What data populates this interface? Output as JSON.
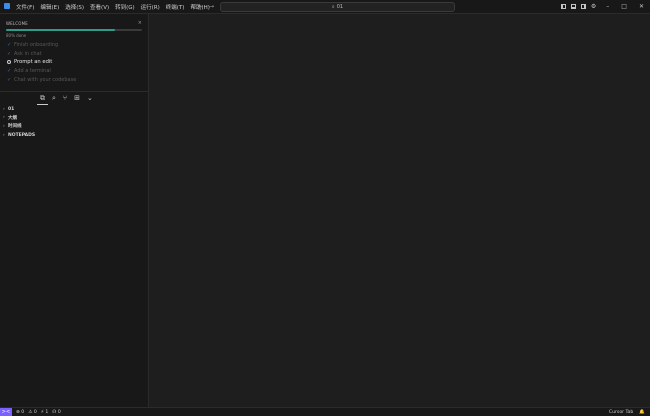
{
  "menu": [
    "文件(F)",
    "编辑(E)",
    "选择(S)",
    "查看(V)",
    "转到(G)",
    "运行(R)",
    "终端(T)",
    "帮助(H)"
  ],
  "nav": {
    "back_icon": "←",
    "forward_icon": "→"
  },
  "command_center": {
    "icon": "⌕",
    "text": "01"
  },
  "title_icons": {
    "settings": "⚙",
    "minimize": "–",
    "maximize": "□",
    "close": "✕"
  },
  "welcome": {
    "title": "WELCOME",
    "close": "×",
    "progress": 0.8,
    "progress_label": "80% done",
    "steps": [
      {
        "label": "Finish onboarding",
        "done": true
      },
      {
        "label": "Ask in chat",
        "done": true
      },
      {
        "label": "Prompt an edit",
        "done": false
      },
      {
        "label": "Add a terminal",
        "done": true
      },
      {
        "label": "Chat with your codebase",
        "done": true
      }
    ]
  },
  "activity": [
    "⧉",
    "⌕",
    "⑂",
    "⊞",
    "⌄"
  ],
  "tree": [
    "01",
    "大纲",
    "时间线",
    "NOTEPADS"
  ],
  "status": {
    "remote": "><",
    "errors": "⊗ 0",
    "warnings": "⚠ 0",
    "ports": "⚡ 1",
    "notifications": "☊ 0",
    "cursor_tab": "Cursor Tab",
    "bell": "🔔"
  }
}
